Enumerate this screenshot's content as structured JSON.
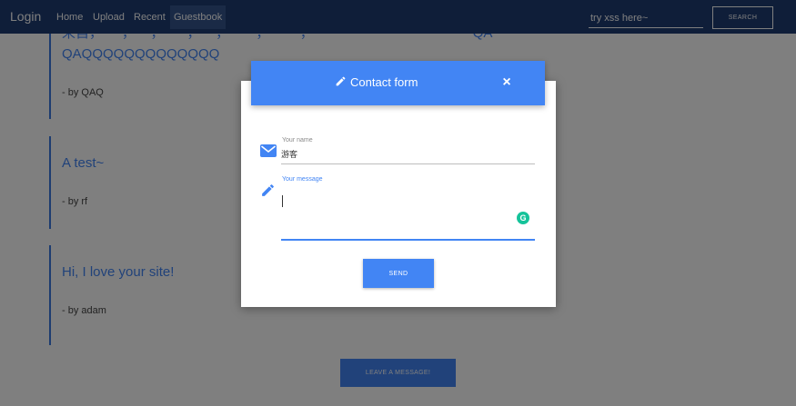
{
  "navbar": {
    "brand": "Login",
    "links": [
      "Home",
      "Upload",
      "Recent",
      "Guestbook"
    ],
    "active_link": "Guestbook",
    "search_placeholder": "try xss here~",
    "search_button": "SEARCH"
  },
  "messages": [
    {
      "title_line1": "来自，     ，    ，      ，    ，       ，        ，                                          QA",
      "title_line2": "QAQQQQQQQQQQQQQ",
      "author": "- by QAQ"
    },
    {
      "title": "A test~",
      "author": "- by rf"
    },
    {
      "title": "Hi, I love your site!",
      "author": "- by adam"
    }
  ],
  "leave_button": "LEAVE A MESSAGE!",
  "modal": {
    "title": "Contact form",
    "close_glyph": "×",
    "name_label": "Your name",
    "name_value": "游客",
    "message_label": "Your message",
    "message_value": "",
    "send_button": "SEND",
    "grammarly_glyph": "G"
  },
  "colors": {
    "navbar": "#1f3c73",
    "accent": "#4285f4",
    "grammarly": "#15c39a"
  },
  "icons": {
    "title_icon": "pencil-icon",
    "name_icon": "envelope-icon",
    "message_icon": "pencil-icon",
    "close_icon": "close-icon",
    "grammarly_icon": "grammarly-icon"
  }
}
